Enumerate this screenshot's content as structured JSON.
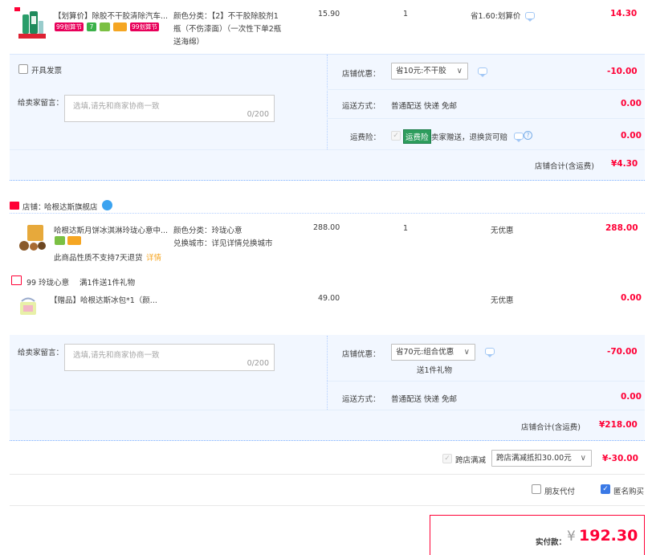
{
  "order1": {
    "item": {
      "title": "【划算价】除胶不干胶清除汽车...",
      "badges": [
        "99划算节",
        "7",
        "",
        "",
        "99划算节"
      ],
      "spec_line1": "颜色分类：【2】不干胶除胶剂1",
      "spec_line2": "瓶（不伤漆面）（一次性下单2瓶",
      "spec_line3": "送海绵）",
      "unit_price": "15.90",
      "qty": "1",
      "discount": "省1.60:划算价",
      "subtotal": "14.30"
    },
    "invoice_label": "开具发票",
    "message_label": "给卖家留言：",
    "message_placeholder": "选填,请先和商家协商一致",
    "message_count": "0/200",
    "store_discount_label": "店铺优惠：",
    "store_discount_value": "省10元:不干胶",
    "store_discount_amount": "-10.00",
    "shipping_label": "运送方式：",
    "shipping_value": "普通配送 快递 免邮",
    "shipping_amount": "0.00",
    "insurance_label": "运费险：",
    "insurance_tag": "运费险",
    "insurance_value": "卖家赠送，退换货可赔",
    "insurance_amount": "0.00",
    "total_label": "店铺合计(含运费)",
    "total_value": "¥4.30"
  },
  "order2": {
    "store_label": "店铺：",
    "store_name": "哈根达斯旗舰店",
    "item": {
      "title": "哈根达斯月饼冰淇淋玲珑心意中...",
      "spec_line1": "颜色分类：玲珑心意",
      "spec_line2": "兑换城市：详见详情兑换城市",
      "unit_price": "288.00",
      "qty": "1",
      "discount": "无优惠",
      "subtotal": "288.00",
      "note": "此商品性质不支持7天退货",
      "note_link": "详情"
    },
    "gift_header": "99 玲珑心意",
    "gift_promo": "满1件送1件礼物",
    "gift": {
      "title": "【赠品】哈根达斯冰包*1（颜...",
      "unit_price": "49.00",
      "discount": "无优惠",
      "subtotal": "0.00"
    },
    "message_label": "给卖家留言：",
    "message_placeholder": "选填,请先和商家协商一致",
    "message_count": "0/200",
    "store_discount_label": "店铺优惠：",
    "store_discount_value": "省70元:组合优惠",
    "store_discount_sub": "送1件礼物",
    "store_discount_amount": "-70.00",
    "shipping_label": "运送方式：",
    "shipping_value": "普通配送 快递 免邮",
    "shipping_amount": "0.00",
    "total_label": "店铺合计(含运费)",
    "total_value": "¥218.00"
  },
  "cross_store": {
    "label": "跨店满减",
    "select_value": "跨店满减抵扣30.00元",
    "amount": "¥-30.00"
  },
  "options": {
    "friend_pay": "朋友代付",
    "anonymous": "匿名购买"
  },
  "payment": {
    "label": "实付款：",
    "currency": "¥",
    "amount": "192.30"
  },
  "colors": {
    "accent_red": "#ff0036",
    "panel_blue": "#f2f7ff",
    "checkbox_blue": "#3a79e6"
  }
}
